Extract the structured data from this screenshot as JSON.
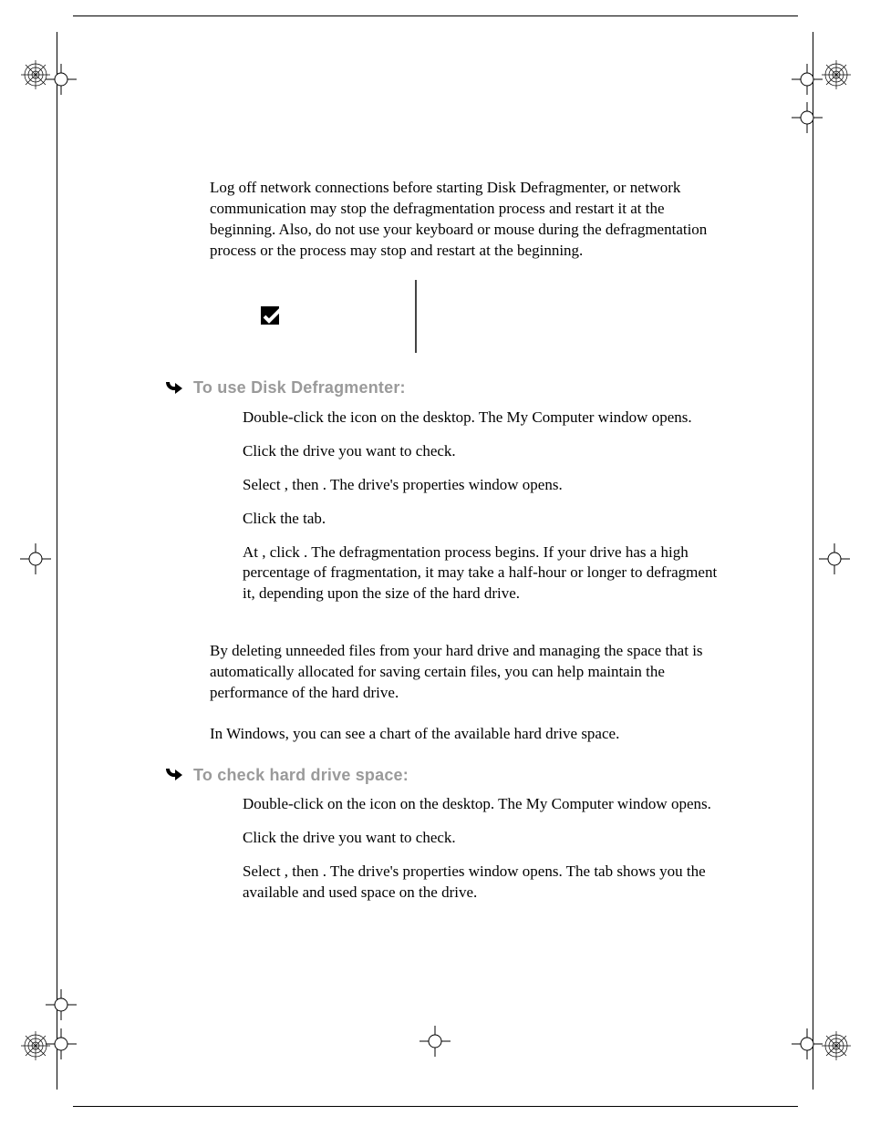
{
  "intro": "Log off network connections before starting Disk Defragmenter, or network communication may stop the defragmentation process and restart it at the beginning. Also, do not use your keyboard or mouse during the defragmentation process or the process may stop and restart at the beginning.",
  "procedures": [
    {
      "title": "To use Disk Defragmenter:",
      "steps": [
        "Double-click the                          icon on the desktop. The My Computer window opens.",
        "Click the drive you want to check.",
        "Select        , then                 . The drive's properties window opens.",
        "Click the           tab.",
        "At                                    , click                         . The defragmentation process begins. If your drive has a high percentage of fragmentation, it may take a half-hour or longer to defragment it, depending upon the size of the hard drive."
      ]
    },
    {
      "title": "To check hard drive space:",
      "steps": [
        "Double-click on the                            icon on the desktop. The My Computer window opens.",
        "Click the drive you want to check.",
        "Select        , then                 . The drive's properties window opens. The               tab shows you the available and used space on the drive."
      ]
    }
  ],
  "section_body": "By deleting unneeded files from your hard drive and managing the space that is automatically allocated for saving certain files, you can help maintain the performance of the hard drive.",
  "sub_body": "In Windows, you can see a chart of the available hard drive space."
}
